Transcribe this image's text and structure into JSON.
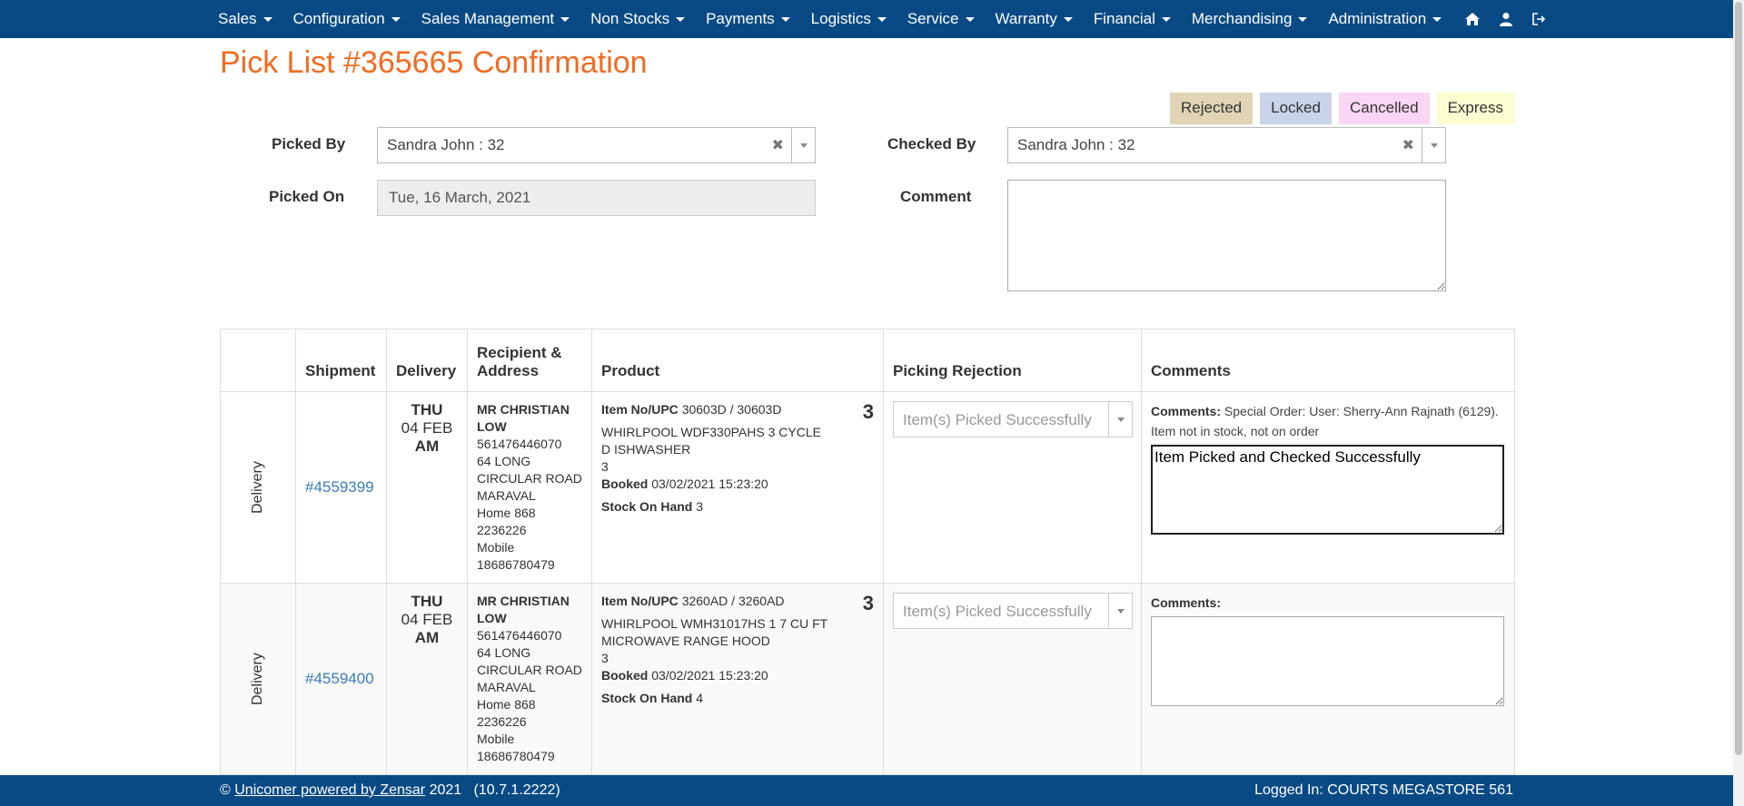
{
  "nav": {
    "items": [
      "Sales",
      "Configuration",
      "Sales Management",
      "Non Stocks",
      "Payments",
      "Logistics",
      "Service",
      "Warranty",
      "Financial",
      "Merchandising",
      "Administration"
    ],
    "icons": [
      "home-icon",
      "user-icon",
      "logout-icon"
    ]
  },
  "page": {
    "title": "Pick List #365665 Confirmation"
  },
  "legend": {
    "rejected": "Rejected",
    "locked": "Locked",
    "cancelled": "Cancelled",
    "express": "Express",
    "colors": {
      "rejected": "#e0d4b4",
      "locked": "#c9d3ea",
      "cancelled": "#f9d6f4",
      "express": "#fdfdd2"
    }
  },
  "form": {
    "picked_by_label": "Picked By",
    "picked_by_value": "Sandra John : 32",
    "picked_on_label": "Picked On",
    "picked_on_value": "Tue, 16 March, 2021",
    "checked_by_label": "Checked By",
    "checked_by_value": "Sandra John : 32",
    "comment_label": "Comment",
    "comment_value": ""
  },
  "table": {
    "headers": {
      "type": "",
      "shipment": "Shipment",
      "delivery": "Delivery",
      "recipient": "Recipient & Address",
      "product": "Product",
      "rejection": "Picking Rejection",
      "comments": "Comments"
    },
    "rows": [
      {
        "type": "Delivery",
        "shipment": "#4559399",
        "day": "THU",
        "date": "04 FEB",
        "slot": "AM",
        "recipient_name": "MR CHRISTIAN LOW",
        "recipient_id": "561476446070",
        "address1": "64 LONG CIRCULAR ROAD",
        "address2": "MARAVAL",
        "home": "Home 868 2236226",
        "mobile": "Mobile 18686780479",
        "item_label": "Item No/UPC",
        "item_no": "30603D / 30603D",
        "qty": "3",
        "description": "WHIRLPOOL WDF330PAHS 3 CYCLE D ISHWASHER",
        "desc_qty": "3",
        "booked_label": "Booked",
        "booked": "03/02/2021 15:23:20",
        "stock_label": "Stock On Hand",
        "stock": "3",
        "rejection_placeholder": "Item(s) Picked Successfully",
        "comments_label": "Comments:",
        "comments_text": "Special Order: User: Sherry-Ann Rajnath (6129). Item not in stock, not on order",
        "comment_value": "Item Picked and Checked Successfully"
      },
      {
        "type": "Delivery",
        "shipment": "#4559400",
        "day": "THU",
        "date": "04 FEB",
        "slot": "AM",
        "recipient_name": "MR CHRISTIAN LOW",
        "recipient_id": "561476446070",
        "address1": "64 LONG CIRCULAR ROAD",
        "address2": "MARAVAL",
        "home": "Home 868 2236226",
        "mobile": "Mobile 18686780479",
        "item_label": "Item No/UPC",
        "item_no": "3260AD / 3260AD",
        "qty": "3",
        "description": "WHIRLPOOL WMH31017HS 1 7 CU FT MICROWAVE RANGE HOOD",
        "desc_qty": "3",
        "booked_label": "Booked",
        "booked": "03/02/2021 15:23:20",
        "stock_label": "Stock On Hand",
        "stock": "4",
        "rejection_placeholder": "Item(s) Picked Successfully",
        "comments_label": "Comments:",
        "comments_text": "",
        "comment_value": ""
      }
    ]
  },
  "footer": {
    "copyright": "©",
    "link_text": "Unicomer powered by Zensar",
    "year_version": "2021   (10.7.1.2222)",
    "logged_in": "Logged In: COURTS MEGASTORE 561"
  }
}
